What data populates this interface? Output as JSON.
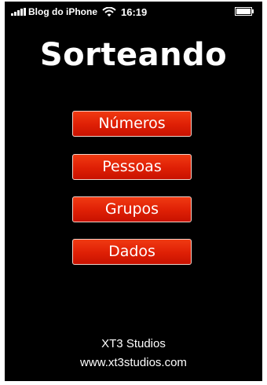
{
  "status_bar": {
    "carrier": "Blog do iPhone",
    "time": "16:19",
    "icons": [
      "signal-icon",
      "wifi-icon",
      "battery-icon"
    ]
  },
  "app": {
    "title": "Sorteando"
  },
  "menu": {
    "items": [
      {
        "label": "Números"
      },
      {
        "label": "Pessoas"
      },
      {
        "label": "Grupos"
      },
      {
        "label": "Dados"
      }
    ]
  },
  "footer": {
    "company": "XT3 Studios",
    "url": "www.xt3studios.com"
  },
  "colors": {
    "background": "#000000",
    "button": "#de1f05",
    "button_border": "#f4d2c8",
    "text": "#ffffff"
  }
}
